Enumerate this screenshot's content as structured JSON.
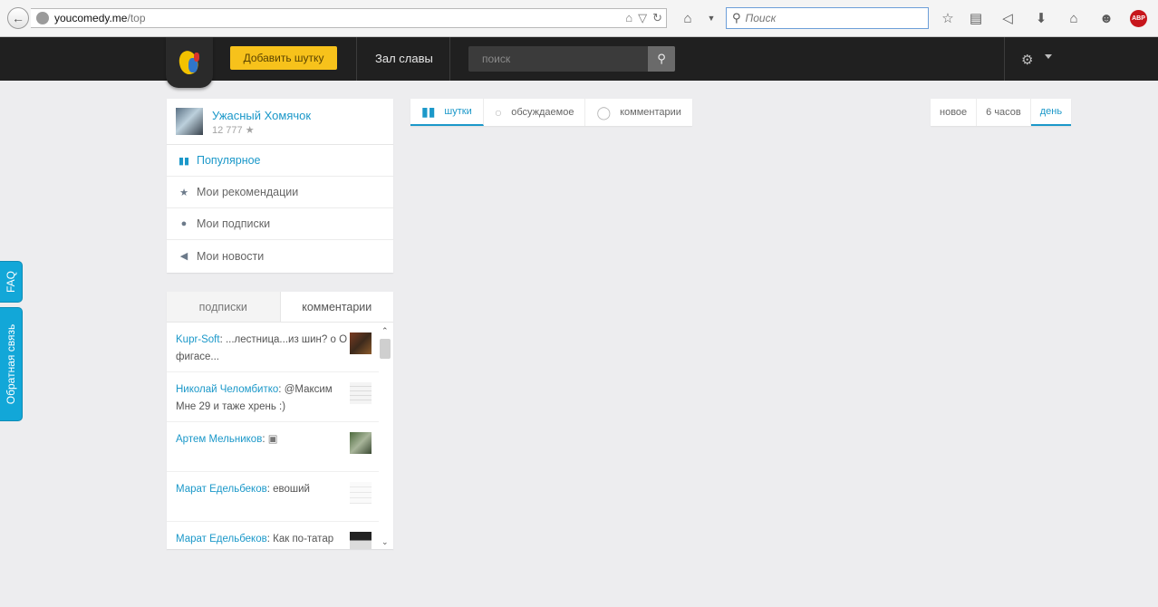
{
  "browser": {
    "url_host": "youcomedy.me",
    "url_path": "/top",
    "search_placeholder": "Поиск",
    "abp_label": "ABP"
  },
  "header": {
    "add_joke_label": "Добавить шутку",
    "hall_of_fame_label": "Зал славы",
    "search_placeholder": "поиск"
  },
  "side_tabs": {
    "faq": "FAQ",
    "feedback": "Обратная связь"
  },
  "profile": {
    "name": "Ужасный Хомячок",
    "score": "12 777",
    "menu": [
      {
        "label": "Популярное",
        "icon": "bar-chart-icon",
        "active": true
      },
      {
        "label": "Мои рекомендации",
        "icon": "star-icon",
        "active": false
      },
      {
        "label": "Мои подписки",
        "icon": "people-icon",
        "active": false
      },
      {
        "label": "Мои новости",
        "icon": "megaphone-icon",
        "active": false
      }
    ]
  },
  "comments_widget": {
    "tabs": [
      {
        "label": "подписки",
        "active": false
      },
      {
        "label": "комментарии",
        "active": true
      }
    ],
    "items": [
      {
        "author": "Kupr-Soft",
        "text": "...лестница...из шин? о О фигасе..."
      },
      {
        "author": "Николай Челомбитко",
        "text": "@Максим Мне 29 и таже хрень :)"
      },
      {
        "author": "Артем Мельников",
        "text": ""
      },
      {
        "author": "Марат Едельбеков",
        "text": "евоший"
      },
      {
        "author": "Марат Едельбеков",
        "text": "Как по-татар"
      }
    ]
  },
  "content_tabs": [
    {
      "label": "шутки",
      "active": true
    },
    {
      "label": "обсуждаемое",
      "active": false
    },
    {
      "label": "комментарии",
      "active": false
    }
  ],
  "period_tabs": [
    {
      "label": "новое",
      "active": false
    },
    {
      "label": "6 часов",
      "active": false
    },
    {
      "label": "день",
      "active": true
    }
  ],
  "colors": {
    "accent": "#1b98c9",
    "add_button": "#f7c21b",
    "header_bg": "#202020",
    "side_tab": "#12a7d8"
  }
}
